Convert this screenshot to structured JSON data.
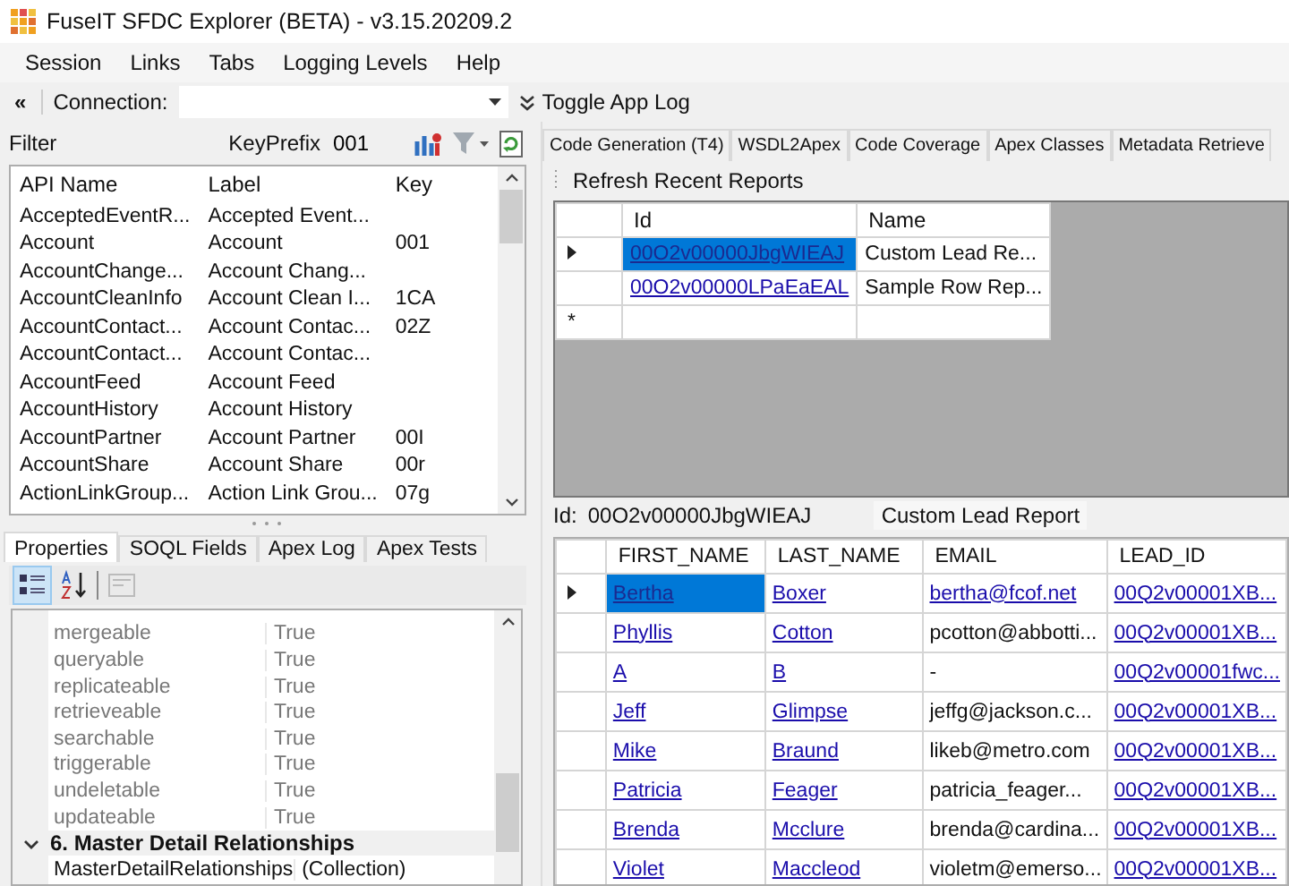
{
  "window": {
    "title": "FuseIT SFDC Explorer (BETA) - v3.15.20209.2"
  },
  "menu": [
    "Session",
    "Links",
    "Tabs",
    "Logging Levels",
    "Help"
  ],
  "toolbar": {
    "collapse": "«",
    "connection_label": "Connection:",
    "toggle_label": "Toggle App Log"
  },
  "filter": {
    "label": "Filter",
    "key_prefix_label": "KeyPrefix",
    "key_prefix_value": "001"
  },
  "objects": {
    "columns": [
      "API Name",
      "Label",
      "Key"
    ],
    "rows": [
      {
        "api_name": "AcceptedEventR...",
        "label": "Accepted Event...",
        "key": ""
      },
      {
        "api_name": "Account",
        "label": "Account",
        "key": "001"
      },
      {
        "api_name": "AccountChange...",
        "label": "Account Chang...",
        "key": ""
      },
      {
        "api_name": "AccountCleanInfo",
        "label": "Account Clean I...",
        "key": "1CA"
      },
      {
        "api_name": "AccountContact...",
        "label": "Account Contac...",
        "key": "02Z"
      },
      {
        "api_name": "AccountContact...",
        "label": "Account Contac...",
        "key": ""
      },
      {
        "api_name": "AccountFeed",
        "label": "Account Feed",
        "key": ""
      },
      {
        "api_name": "AccountHistory",
        "label": "Account History",
        "key": ""
      },
      {
        "api_name": "AccountPartner",
        "label": "Account Partner",
        "key": "00I"
      },
      {
        "api_name": "AccountShare",
        "label": "Account Share",
        "key": "00r"
      },
      {
        "api_name": "ActionLinkGroup...",
        "label": "Action Link Grou...",
        "key": "07g"
      }
    ]
  },
  "lower_tabs": [
    {
      "label": "Properties",
      "selected": true
    },
    {
      "label": "SOQL Fields",
      "selected": false
    },
    {
      "label": "Apex Log",
      "selected": false
    },
    {
      "label": "Apex Tests",
      "selected": false
    }
  ],
  "property_toolbar": {
    "categorized_pressed": true,
    "property_pages_disabled": true
  },
  "properties": [
    {
      "kind": "property",
      "name": "mergeable",
      "value": "True",
      "read_only": true
    },
    {
      "kind": "property",
      "name": "queryable",
      "value": "True",
      "read_only": true
    },
    {
      "kind": "property",
      "name": "replicateable",
      "value": "True",
      "read_only": true
    },
    {
      "kind": "property",
      "name": "retrieveable",
      "value": "True",
      "read_only": true
    },
    {
      "kind": "property",
      "name": "searchable",
      "value": "True",
      "read_only": true
    },
    {
      "kind": "property",
      "name": "triggerable",
      "value": "True",
      "read_only": true
    },
    {
      "kind": "property",
      "name": "undeletable",
      "value": "True",
      "read_only": true
    },
    {
      "kind": "property",
      "name": "updateable",
      "value": "True",
      "read_only": true
    },
    {
      "kind": "category",
      "name": "6. Master Detail Relationships",
      "expanded": true
    },
    {
      "kind": "property",
      "name": "MasterDetailRelationships",
      "value": "(Collection)",
      "read_only": false
    }
  ],
  "main_tabs": [
    {
      "label": "Code Generation (T4)",
      "selected": false
    },
    {
      "label": "WSDL2Apex",
      "selected": false
    },
    {
      "label": "Code Coverage",
      "selected": false
    },
    {
      "label": "Apex Classes",
      "selected": false
    },
    {
      "label": "Metadata Retrieve",
      "selected": false
    }
  ],
  "recent_reports": {
    "button": "Refresh Recent Reports",
    "columns": [
      "Id",
      "Name"
    ],
    "new_row_marker": "*",
    "rows": [
      {
        "id": "00O2v00000JbgWIEAJ",
        "name": "Custom Lead Re...",
        "selected": true
      },
      {
        "id": "00O2v00000LPaEaEAL",
        "name": "Sample Row Rep...",
        "selected": false
      }
    ]
  },
  "report_header": {
    "id_label": "Id:",
    "id": "00O2v00000JbgWIEAJ",
    "name": "Custom Lead Report"
  },
  "report_grid": {
    "columns": [
      "FIRST_NAME",
      "LAST_NAME",
      "EMAIL",
      "LEAD_ID"
    ],
    "rows": [
      {
        "selected": true,
        "cells": [
          {
            "text": "Bertha",
            "link": true
          },
          {
            "text": "Boxer",
            "link": true
          },
          {
            "text": "bertha@fcof.net",
            "link": true
          },
          {
            "text": "00Q2v00001XB...",
            "link": true
          }
        ]
      },
      {
        "selected": false,
        "cells": [
          {
            "text": "Phyllis",
            "link": true
          },
          {
            "text": "Cotton",
            "link": true
          },
          {
            "text": "pcotton@abbotti...",
            "link": false
          },
          {
            "text": "00Q2v00001XB...",
            "link": true
          }
        ]
      },
      {
        "selected": false,
        "cells": [
          {
            "text": "A",
            "link": true
          },
          {
            "text": "B",
            "link": true
          },
          {
            "text": "-",
            "link": false
          },
          {
            "text": "00Q2v00001fwc...",
            "link": true
          }
        ]
      },
      {
        "selected": false,
        "cells": [
          {
            "text": "Jeff",
            "link": true
          },
          {
            "text": "Glimpse",
            "link": true
          },
          {
            "text": "jeffg@jackson.c...",
            "link": false
          },
          {
            "text": "00Q2v00001XB...",
            "link": true
          }
        ]
      },
      {
        "selected": false,
        "cells": [
          {
            "text": "Mike",
            "link": true
          },
          {
            "text": "Braund",
            "link": true
          },
          {
            "text": "likeb@metro.com",
            "link": false
          },
          {
            "text": "00Q2v00001XB...",
            "link": true
          }
        ]
      },
      {
        "selected": false,
        "cells": [
          {
            "text": "Patricia",
            "link": true
          },
          {
            "text": "Feager",
            "link": true
          },
          {
            "text": "patricia_feager...",
            "link": false
          },
          {
            "text": "00Q2v00001XB...",
            "link": true
          }
        ]
      },
      {
        "selected": false,
        "cells": [
          {
            "text": "Brenda",
            "link": true
          },
          {
            "text": "Mcclure",
            "link": true
          },
          {
            "text": "brenda@cardina...",
            "link": false
          },
          {
            "text": "00Q2v00001XB...",
            "link": true
          }
        ]
      },
      {
        "selected": false,
        "cells": [
          {
            "text": "Violet",
            "link": true
          },
          {
            "text": "Maccleod",
            "link": true
          },
          {
            "text": "violetm@emerso...",
            "link": false
          },
          {
            "text": "00Q2v00001XB...",
            "link": true
          }
        ]
      }
    ]
  }
}
